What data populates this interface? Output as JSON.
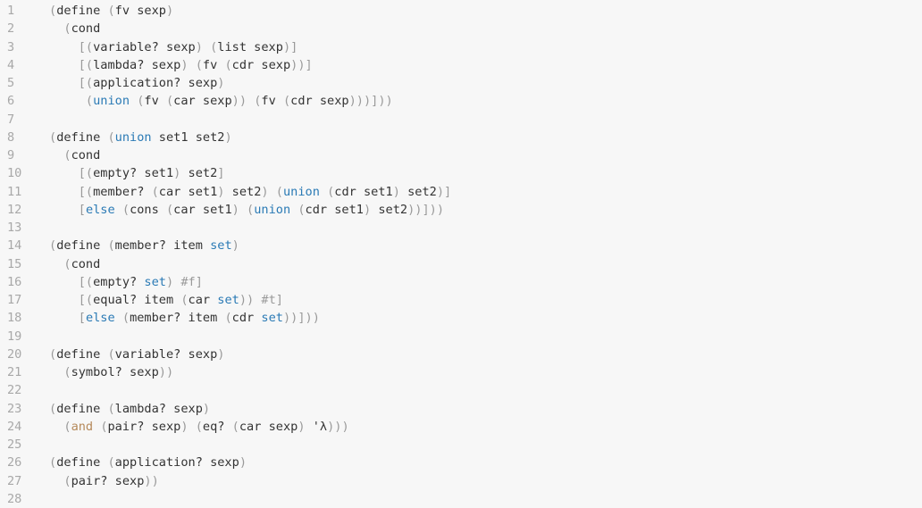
{
  "editor": {
    "language": "scheme",
    "colors": {
      "background": "#f7f7f7",
      "text": "#333333",
      "punctuation": "#9a9a9a",
      "builtin_blue": "#2a7ab5",
      "keyword_orange": "#b5895a",
      "line_number": "#a8a8a8"
    },
    "lines": [
      {
        "n": "1",
        "tokens": [
          [
            "p",
            "("
          ],
          [
            "k",
            "define "
          ],
          [
            "p",
            "("
          ],
          [
            "k",
            "fv sexp"
          ],
          [
            "p",
            ")"
          ]
        ]
      },
      {
        "n": "2",
        "tokens": [
          [
            "k",
            "  "
          ],
          [
            "p",
            "("
          ],
          [
            "k",
            "cond"
          ]
        ]
      },
      {
        "n": "3",
        "tokens": [
          [
            "k",
            "    "
          ],
          [
            "p",
            "[("
          ],
          [
            "k",
            "variable? sexp"
          ],
          [
            "p",
            ") ("
          ],
          [
            "k",
            "list sexp"
          ],
          [
            "p",
            ")]"
          ]
        ]
      },
      {
        "n": "4",
        "tokens": [
          [
            "k",
            "    "
          ],
          [
            "p",
            "[("
          ],
          [
            "k",
            "lambda? sexp"
          ],
          [
            "p",
            ") ("
          ],
          [
            "k",
            "fv "
          ],
          [
            "p",
            "("
          ],
          [
            "k",
            "cdr sexp"
          ],
          [
            "p",
            "))]"
          ]
        ]
      },
      {
        "n": "5",
        "tokens": [
          [
            "k",
            "    "
          ],
          [
            "p",
            "[("
          ],
          [
            "k",
            "application? sexp"
          ],
          [
            "p",
            ")"
          ]
        ]
      },
      {
        "n": "6",
        "tokens": [
          [
            "k",
            "     "
          ],
          [
            "p",
            "("
          ],
          [
            "b",
            "union"
          ],
          [
            "k",
            " "
          ],
          [
            "p",
            "("
          ],
          [
            "k",
            "fv "
          ],
          [
            "p",
            "("
          ],
          [
            "k",
            "car sexp"
          ],
          [
            "p",
            ")) ("
          ],
          [
            "k",
            "fv "
          ],
          [
            "p",
            "("
          ],
          [
            "k",
            "cdr sexp"
          ],
          [
            "p",
            ")))]))"
          ]
        ]
      },
      {
        "n": "7",
        "tokens": []
      },
      {
        "n": "8",
        "tokens": [
          [
            "p",
            "("
          ],
          [
            "k",
            "define "
          ],
          [
            "p",
            "("
          ],
          [
            "b",
            "union"
          ],
          [
            "k",
            " set1 set2"
          ],
          [
            "p",
            ")"
          ]
        ]
      },
      {
        "n": "9",
        "tokens": [
          [
            "k",
            "  "
          ],
          [
            "p",
            "("
          ],
          [
            "k",
            "cond"
          ]
        ]
      },
      {
        "n": "10",
        "tokens": [
          [
            "k",
            "    "
          ],
          [
            "p",
            "[("
          ],
          [
            "k",
            "empty? set1"
          ],
          [
            "p",
            ") "
          ],
          [
            "k",
            "set2"
          ],
          [
            "p",
            "]"
          ]
        ]
      },
      {
        "n": "11",
        "tokens": [
          [
            "k",
            "    "
          ],
          [
            "p",
            "[("
          ],
          [
            "k",
            "member? "
          ],
          [
            "p",
            "("
          ],
          [
            "k",
            "car set1"
          ],
          [
            "p",
            ") "
          ],
          [
            "k",
            "set2"
          ],
          [
            "p",
            ") ("
          ],
          [
            "b",
            "union"
          ],
          [
            "k",
            " "
          ],
          [
            "p",
            "("
          ],
          [
            "k",
            "cdr set1"
          ],
          [
            "p",
            ") "
          ],
          [
            "k",
            "set2"
          ],
          [
            "p",
            ")]"
          ]
        ]
      },
      {
        "n": "12",
        "tokens": [
          [
            "k",
            "    "
          ],
          [
            "p",
            "["
          ],
          [
            "b",
            "else"
          ],
          [
            "k",
            " "
          ],
          [
            "p",
            "("
          ],
          [
            "k",
            "cons "
          ],
          [
            "p",
            "("
          ],
          [
            "k",
            "car set1"
          ],
          [
            "p",
            ") ("
          ],
          [
            "b",
            "union"
          ],
          [
            "k",
            " "
          ],
          [
            "p",
            "("
          ],
          [
            "k",
            "cdr set1"
          ],
          [
            "p",
            ") "
          ],
          [
            "k",
            "set2"
          ],
          [
            "p",
            "))]))"
          ]
        ]
      },
      {
        "n": "13",
        "tokens": []
      },
      {
        "n": "14",
        "tokens": [
          [
            "p",
            "("
          ],
          [
            "k",
            "define "
          ],
          [
            "p",
            "("
          ],
          [
            "k",
            "member? item "
          ],
          [
            "b",
            "set"
          ],
          [
            "p",
            ")"
          ]
        ]
      },
      {
        "n": "15",
        "tokens": [
          [
            "k",
            "  "
          ],
          [
            "p",
            "("
          ],
          [
            "k",
            "cond"
          ]
        ]
      },
      {
        "n": "16",
        "tokens": [
          [
            "k",
            "    "
          ],
          [
            "p",
            "[("
          ],
          [
            "k",
            "empty? "
          ],
          [
            "b",
            "set"
          ],
          [
            "p",
            ") #f]"
          ]
        ]
      },
      {
        "n": "17",
        "tokens": [
          [
            "k",
            "    "
          ],
          [
            "p",
            "[("
          ],
          [
            "k",
            "equal? item "
          ],
          [
            "p",
            "("
          ],
          [
            "k",
            "car "
          ],
          [
            "b",
            "set"
          ],
          [
            "p",
            "))"
          ],
          [
            "p",
            " #t]"
          ]
        ]
      },
      {
        "n": "18",
        "tokens": [
          [
            "k",
            "    "
          ],
          [
            "p",
            "["
          ],
          [
            "b",
            "else"
          ],
          [
            "k",
            " "
          ],
          [
            "p",
            "("
          ],
          [
            "k",
            "member? item "
          ],
          [
            "p",
            "("
          ],
          [
            "k",
            "cdr "
          ],
          [
            "b",
            "set"
          ],
          [
            "p",
            ")"
          ],
          [
            "p",
            ")]))"
          ]
        ]
      },
      {
        "n": "19",
        "tokens": []
      },
      {
        "n": "20",
        "tokens": [
          [
            "p",
            "("
          ],
          [
            "k",
            "define "
          ],
          [
            "p",
            "("
          ],
          [
            "k",
            "variable? sexp"
          ],
          [
            "p",
            ")"
          ]
        ]
      },
      {
        "n": "21",
        "tokens": [
          [
            "k",
            "  "
          ],
          [
            "p",
            "("
          ],
          [
            "k",
            "symbol? sexp"
          ],
          [
            "p",
            "))"
          ]
        ]
      },
      {
        "n": "22",
        "tokens": []
      },
      {
        "n": "23",
        "tokens": [
          [
            "p",
            "("
          ],
          [
            "k",
            "define "
          ],
          [
            "p",
            "("
          ],
          [
            "k",
            "lambda? sexp"
          ],
          [
            "p",
            ")"
          ]
        ]
      },
      {
        "n": "24",
        "tokens": [
          [
            "k",
            "  "
          ],
          [
            "p",
            "("
          ],
          [
            "o",
            "and"
          ],
          [
            "k",
            " "
          ],
          [
            "p",
            "("
          ],
          [
            "k",
            "pair? sexp"
          ],
          [
            "p",
            ") ("
          ],
          [
            "k",
            "eq? "
          ],
          [
            "p",
            "("
          ],
          [
            "k",
            "car sexp"
          ],
          [
            "p",
            ") "
          ],
          [
            "k",
            "'λ"
          ],
          [
            "p",
            ")))"
          ]
        ]
      },
      {
        "n": "25",
        "tokens": []
      },
      {
        "n": "26",
        "tokens": [
          [
            "p",
            "("
          ],
          [
            "k",
            "define "
          ],
          [
            "p",
            "("
          ],
          [
            "k",
            "application? sexp"
          ],
          [
            "p",
            ")"
          ]
        ]
      },
      {
        "n": "27",
        "tokens": [
          [
            "k",
            "  "
          ],
          [
            "p",
            "("
          ],
          [
            "k",
            "pair? sexp"
          ],
          [
            "p",
            "))"
          ]
        ]
      },
      {
        "n": "28",
        "tokens": []
      }
    ]
  }
}
